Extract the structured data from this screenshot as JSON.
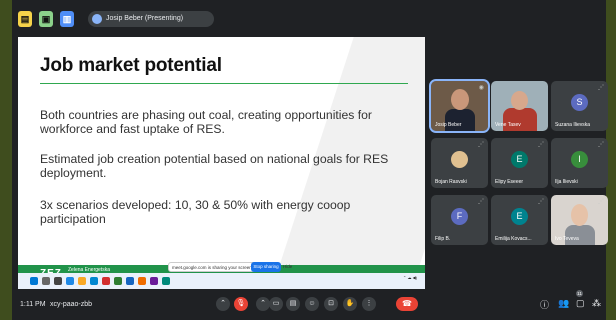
{
  "topbar": {
    "presenter_label": "Josip Beber (Presenting)"
  },
  "slide": {
    "title": "Job market potential",
    "paragraphs": [
      "Both countries are phasing out coal, creating opportunities for workforce and fast uptake of RES.",
      "Estimated job creation potential based on national goals for RES deployment.",
      "3x scenarios developed: 10, 30 & 50% with energy cooop participation"
    ],
    "logo_text": "ZEZ",
    "logo_sub": "Zelena Energetska",
    "share_notice": "meet.google.com is sharing your screen.",
    "share_stop_label": "Stop sharing",
    "share_hide_label": "Hide",
    "accent_color": "#2fa84f"
  },
  "participants": [
    {
      "name": "Josip Beber",
      "type": "photo",
      "active": true
    },
    {
      "name": "Vene Tasev",
      "type": "photo"
    },
    {
      "name": "Suzana Ilievska",
      "type": "avatar",
      "initial": "S",
      "color": "#5c6bc0"
    },
    {
      "name": "Bojan Rasvski",
      "type": "avatar-photo"
    },
    {
      "name": "Elipy Eseeer",
      "type": "avatar",
      "initial": "E",
      "color": "#00796b"
    },
    {
      "name": "Ilja Ilievski",
      "type": "avatar",
      "initial": "I",
      "color": "#388e3c"
    },
    {
      "name": "Filip B.",
      "type": "avatar",
      "initial": "F",
      "color": "#5c6bc0"
    },
    {
      "name": "Emilija Kovacs...",
      "type": "avatar",
      "initial": "E",
      "color": "#00838f"
    },
    {
      "name": "Ivo Teveva",
      "type": "photo"
    }
  ],
  "bottombar": {
    "time": "1:11 PM",
    "meeting_code": "xcy-paao-zbb",
    "people_count": "11"
  },
  "colors": {
    "call_end": "#ea4335",
    "frame": "#3f4d1e"
  }
}
